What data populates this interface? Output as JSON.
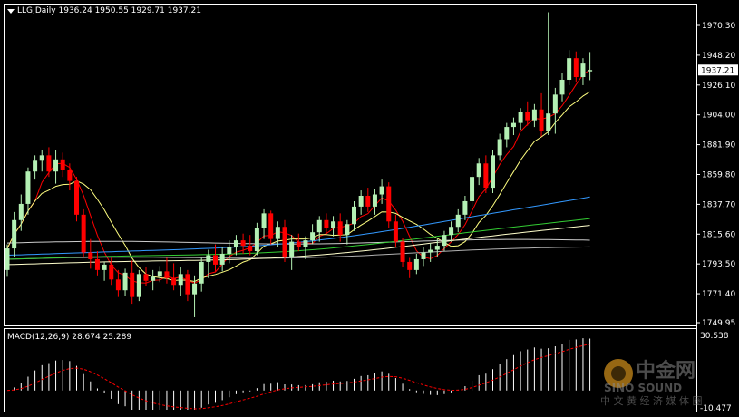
{
  "header": {
    "symbol_line": "LLG,Daily  1936.24 1950.55 1929.71 1937.21"
  },
  "macd_header": {
    "label": "MACD(12,26,9) 28.674 25.289"
  },
  "watermark": {
    "brand_cn": "中金网",
    "brand_en": "SINO SOUND",
    "slogan": "中 文 黄 经 济 媒 体 圈"
  },
  "colors": {
    "background": "#000000",
    "bull": "#b4f0b4",
    "bear": "#ff0000",
    "price_tag": "#ffffff",
    "ma5": "#ff0000",
    "ma10": "#ffff80",
    "ma20": "#3399ff",
    "ma30": "#33cc33",
    "ma60": "#ffffcc",
    "ma120": "#cccccc",
    "ma250": "#b0b0b0",
    "macd_hist": "#ffffff",
    "macd_signal": "#ff0000"
  },
  "chart_data": {
    "type": "candlestick",
    "price_axis": {
      "ticks": [
        1970.3,
        1948.2,
        1926.1,
        1904.0,
        1881.9,
        1859.8,
        1837.7,
        1815.6,
        1793.5,
        1771.4,
        1749.95
      ],
      "tick_labels": [
        "1970.30",
        "1948.20",
        "1926.10",
        "1904.00",
        "1881.90",
        "1859.80",
        "1837.70",
        "1815.60",
        "1793.50",
        "1771.40",
        "1749.95"
      ],
      "range": [
        1749.95,
        1982.0
      ],
      "current_price": 1937.21,
      "current_label": "1937.21"
    },
    "candles": [
      [
        1789,
        1808,
        1784,
        1805
      ],
      [
        1805,
        1832,
        1799,
        1826
      ],
      [
        1826,
        1845,
        1818,
        1838
      ],
      [
        1838,
        1865,
        1830,
        1862
      ],
      [
        1862,
        1874,
        1856,
        1870
      ],
      [
        1870,
        1878,
        1862,
        1874
      ],
      [
        1874,
        1880,
        1858,
        1862
      ],
      [
        1862,
        1878,
        1853,
        1871
      ],
      [
        1871,
        1876,
        1858,
        1863
      ],
      [
        1863,
        1868,
        1848,
        1855
      ],
      [
        1855,
        1858,
        1825,
        1830
      ],
      [
        1830,
        1834,
        1799,
        1802
      ],
      [
        1802,
        1812,
        1790,
        1797
      ],
      [
        1797,
        1803,
        1785,
        1789
      ],
      [
        1789,
        1795,
        1781,
        1793
      ],
      [
        1793,
        1798,
        1778,
        1782
      ],
      [
        1782,
        1789,
        1769,
        1774
      ],
      [
        1774,
        1790,
        1770,
        1787
      ],
      [
        1787,
        1796,
        1764,
        1769
      ],
      [
        1769,
        1789,
        1766,
        1786
      ],
      [
        1786,
        1791,
        1777,
        1781
      ],
      [
        1781,
        1789,
        1774,
        1784
      ],
      [
        1784,
        1792,
        1780,
        1788
      ],
      [
        1788,
        1798,
        1779,
        1783
      ],
      [
        1783,
        1794,
        1774,
        1778
      ],
      [
        1778,
        1791,
        1770,
        1786
      ],
      [
        1786,
        1789,
        1766,
        1771
      ],
      [
        1771,
        1785,
        1754,
        1779
      ],
      [
        1779,
        1798,
        1773,
        1795
      ],
      [
        1795,
        1804,
        1783,
        1800
      ],
      [
        1800,
        1808,
        1788,
        1793
      ],
      [
        1793,
        1806,
        1788,
        1801
      ],
      [
        1801,
        1811,
        1794,
        1806
      ],
      [
        1806,
        1815,
        1800,
        1811
      ],
      [
        1811,
        1816,
        1801,
        1807
      ],
      [
        1807,
        1815,
        1800,
        1803
      ],
      [
        1803,
        1824,
        1800,
        1820
      ],
      [
        1820,
        1834,
        1812,
        1831
      ],
      [
        1831,
        1833,
        1808,
        1812
      ],
      [
        1812,
        1825,
        1806,
        1821
      ],
      [
        1821,
        1826,
        1795,
        1799
      ],
      [
        1799,
        1815,
        1789,
        1810
      ],
      [
        1810,
        1816,
        1803,
        1806
      ],
      [
        1806,
        1814,
        1797,
        1811
      ],
      [
        1811,
        1823,
        1808,
        1817
      ],
      [
        1817,
        1829,
        1810,
        1826
      ],
      [
        1826,
        1831,
        1816,
        1820
      ],
      [
        1820,
        1829,
        1814,
        1825
      ],
      [
        1825,
        1831,
        1810,
        1815
      ],
      [
        1815,
        1826,
        1808,
        1823
      ],
      [
        1823,
        1840,
        1818,
        1836
      ],
      [
        1836,
        1848,
        1830,
        1844
      ],
      [
        1844,
        1850,
        1832,
        1836
      ],
      [
        1836,
        1849,
        1830,
        1845
      ],
      [
        1845,
        1856,
        1838,
        1851
      ],
      [
        1851,
        1854,
        1820,
        1825
      ],
      [
        1825,
        1830,
        1806,
        1810
      ],
      [
        1810,
        1813,
        1791,
        1795
      ],
      [
        1795,
        1798,
        1783,
        1789
      ],
      [
        1789,
        1801,
        1786,
        1797
      ],
      [
        1797,
        1806,
        1792,
        1802
      ],
      [
        1802,
        1809,
        1795,
        1804
      ],
      [
        1804,
        1812,
        1799,
        1807
      ],
      [
        1807,
        1818,
        1803,
        1815
      ],
      [
        1815,
        1825,
        1810,
        1821
      ],
      [
        1821,
        1834,
        1817,
        1830
      ],
      [
        1830,
        1844,
        1826,
        1840
      ],
      [
        1840,
        1862,
        1836,
        1858
      ],
      [
        1858,
        1872,
        1852,
        1868
      ],
      [
        1868,
        1874,
        1846,
        1850
      ],
      [
        1850,
        1878,
        1846,
        1874
      ],
      [
        1874,
        1890,
        1870,
        1886
      ],
      [
        1886,
        1898,
        1880,
        1895
      ],
      [
        1895,
        1902,
        1889,
        1898
      ],
      [
        1898,
        1909,
        1893,
        1906
      ],
      [
        1906,
        1914,
        1896,
        1900
      ],
      [
        1900,
        1912,
        1895,
        1908
      ],
      [
        1908,
        1920,
        1888,
        1892
      ],
      [
        1892,
        1980,
        1889,
        1905
      ],
      [
        1905,
        1924,
        1890,
        1919
      ],
      [
        1919,
        1935,
        1914,
        1930
      ],
      [
        1930,
        1952,
        1926,
        1946
      ],
      [
        1946,
        1951,
        1928,
        1932
      ],
      [
        1932,
        1946,
        1926,
        1942
      ],
      [
        1936.24,
        1950.55,
        1929.71,
        1937.21
      ]
    ],
    "series": [
      {
        "name": "MA5"
      },
      {
        "name": "MA10"
      },
      {
        "name": "MA20"
      },
      {
        "name": "MA30"
      },
      {
        "name": "MA60"
      },
      {
        "name": "MA120"
      },
      {
        "name": "MA250"
      }
    ],
    "long_ma_endpoints": {
      "MA20": [
        1800,
        1843
      ],
      "MA30": [
        1797,
        1827
      ],
      "MA60": [
        1793,
        1822
      ],
      "MA120": [
        1809,
        1811
      ],
      "MA250": [
        1797,
        1806
      ]
    },
    "macd": {
      "axis_ticks": [
        30.538,
        -10.477
      ],
      "tick_labels": [
        "30.538",
        "-10.477"
      ],
      "range": [
        -10.477,
        30.538
      ]
    },
    "grid": false
  }
}
